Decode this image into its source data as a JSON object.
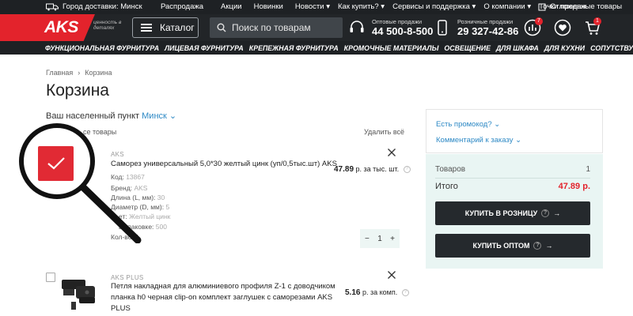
{
  "top_strip": {
    "delivery_label": "Город доставки: Минск",
    "nav": [
      "Распродажа",
      "Акции",
      "Новинки",
      "Новости ▾",
      "Как купить? ▾",
      "Сервисы и поддержка ▾",
      "О компании ▾",
      "Точки продаж"
    ],
    "deferred_label": "Отложенные товары"
  },
  "header": {
    "logo": "AKS",
    "tagline": "ценность в деталях",
    "catalog_label": "Каталог",
    "search_placeholder": "Поиск по товарам",
    "wholesale_label": "Оптовые продажи",
    "wholesale_phone": "44 500-8-500",
    "retail_label": "Розничные продажи",
    "retail_phone": "29 327-42-86",
    "compare_badge": "7",
    "cart_badge": "1"
  },
  "categories": [
    "ФУНКЦИОНАЛЬНАЯ ФУРНИТУРА",
    "ЛИЦЕВАЯ ФУРНИТУРА",
    "КРЕПЕЖНАЯ ФУРНИТУРА",
    "КРОМОЧНЫЕ МАТЕРИАЛЫ",
    "ОСВЕЩЕНИЕ",
    "ДЛЯ ШКАФА",
    "ДЛЯ КУХНИ",
    "СОПУТСТВУЮЩИЕ"
  ],
  "breadcrumb": {
    "home": "Главная",
    "current": "Корзина"
  },
  "page_title": "Корзина",
  "locality": {
    "label": "Ваш населенный пункт",
    "city": "Минск"
  },
  "list": {
    "select_all": "се товары",
    "delete_all": "Удалить всё"
  },
  "items": [
    {
      "brand": "AKS",
      "name": "Саморез универсальный 5,0*30 желтый цинк (уп/0,5тыс.шт) AKS",
      "price": "47.89",
      "price_unit": "р. за тыс. шт.",
      "specs": [
        {
          "k": "Код:",
          "v": "13867"
        },
        {
          "k": "Бренд:",
          "v": "AKS"
        },
        {
          "k": "Длина (L, мм):",
          "v": "30"
        },
        {
          "k": "Диаметр (D, мм):",
          "v": "5"
        },
        {
          "k": "ет:",
          "v": "Желтый цинк"
        },
        {
          "k": "в упаковке:",
          "v": "500"
        },
        {
          "k": "Кол-во:",
          "v": "1"
        }
      ],
      "qty": "1"
    },
    {
      "brand": "AKS PLUS",
      "name_line1": "Петля накладная для алюминиевого профиля Z-1 с доводчиком",
      "name_line2": "планка h0 черная clip-on комплект заглушек с саморезами AKS",
      "name_line3": "PLUS",
      "price": "5.16",
      "price_unit": "р. за комп."
    }
  ],
  "sidebar": {
    "promo_link": "Есть промокод?",
    "comment_link": "Комментарий к заказу",
    "goods_label": "Товаров",
    "goods_count": "1",
    "total_label": "Итого",
    "total_value": "47.89 р.",
    "buy_retail": "КУПИТЬ В РОЗНИЦУ",
    "buy_wholesale": "КУПИТЬ ОПТОМ"
  },
  "colors": {
    "accent": "#e3232c",
    "link": "#2d89c5",
    "dark": "#222528",
    "panel": "#e9f5f3"
  }
}
